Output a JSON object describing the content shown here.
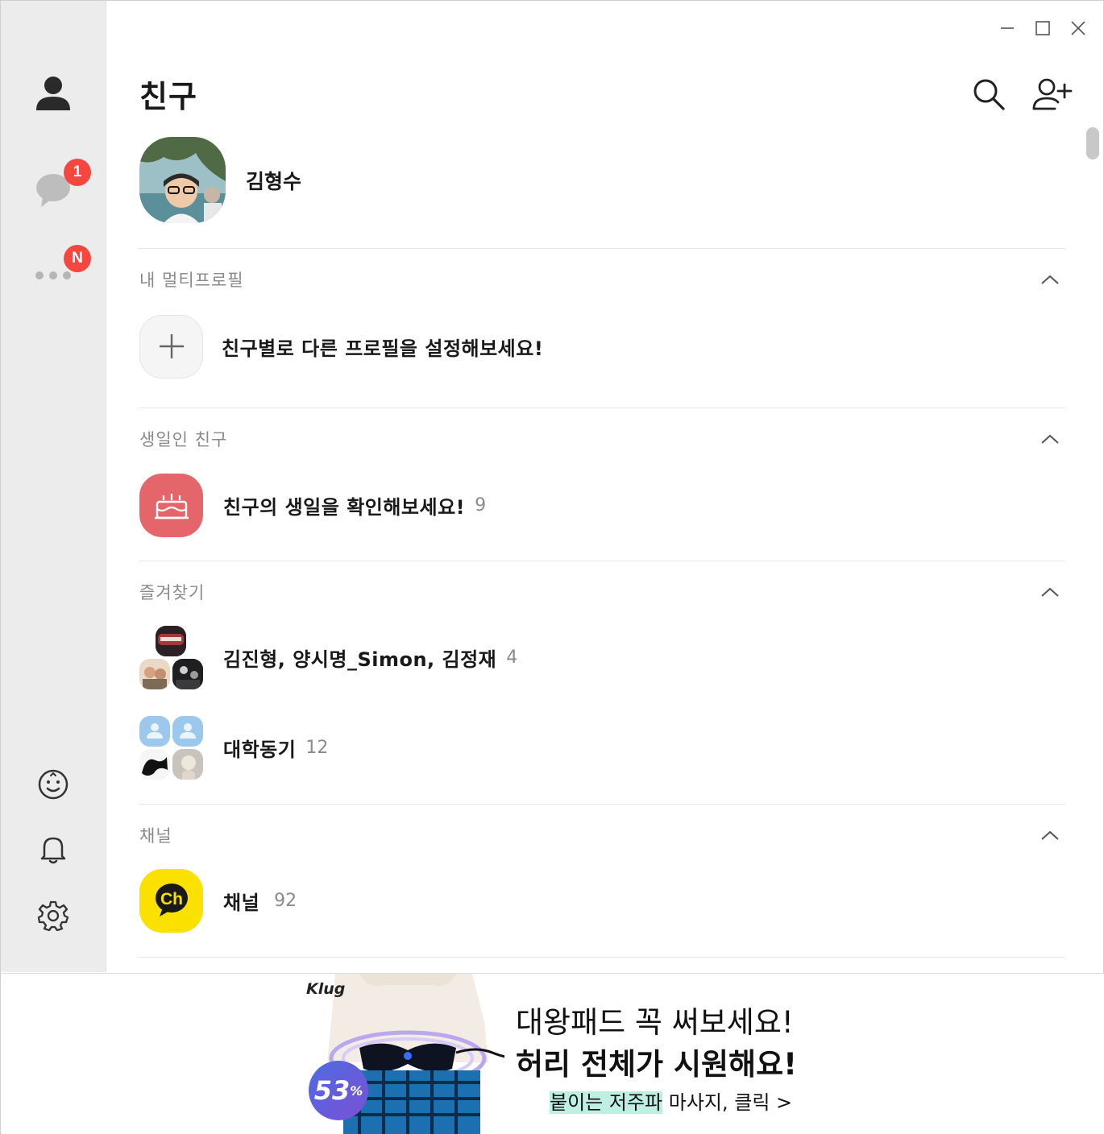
{
  "header": {
    "title": "친구",
    "search_icon": "search-icon",
    "add_friend_icon": "add-friend-icon"
  },
  "sidebar": {
    "items": [
      {
        "name": "friends",
        "icon": "person-icon"
      },
      {
        "name": "chats",
        "icon": "chat-bubble-icon",
        "badge": "1"
      },
      {
        "name": "more",
        "icon": "more-dots-icon",
        "badge": "N"
      }
    ],
    "bottom": [
      {
        "name": "emoticon",
        "icon": "smiley-icon"
      },
      {
        "name": "notifications",
        "icon": "bell-icon"
      },
      {
        "name": "settings",
        "icon": "gear-icon"
      }
    ]
  },
  "profile": {
    "name": "김형수"
  },
  "sections": {
    "multi_profile": {
      "title": "내 멀티프로필",
      "row_label": "친구별로 다른 프로필을 설정해보세요!"
    },
    "birthday": {
      "title": "생일인 친구",
      "row_label": "친구의 생일을 확인해보세요!",
      "row_count": "9"
    },
    "favorites": {
      "title": "즐겨찾기",
      "rows": [
        {
          "label": "김진형, 양시명_Simon, 김정재",
          "count": "4"
        },
        {
          "label": "대학동기",
          "count": "12"
        }
      ]
    },
    "channel": {
      "title": "채널",
      "row_label": "채널",
      "row_count": "92",
      "icon_text": "Ch"
    }
  },
  "ad": {
    "brand": "Klug",
    "line1": "대왕패드 꼭 써보세요!",
    "line2": "허리 전체가 시원해요!",
    "line3_highlight": "붙이는 저주파",
    "line3_rest": " 마사지, 클릭 >",
    "discount": "53",
    "discount_unit": "%"
  },
  "colors": {
    "sidebar_bg": "#ececec",
    "badge_red": "#f5473f",
    "birthday_icon_bg": "#e4666b",
    "channel_icon_bg": "#fae100",
    "section_title": "#8a8a8a"
  }
}
